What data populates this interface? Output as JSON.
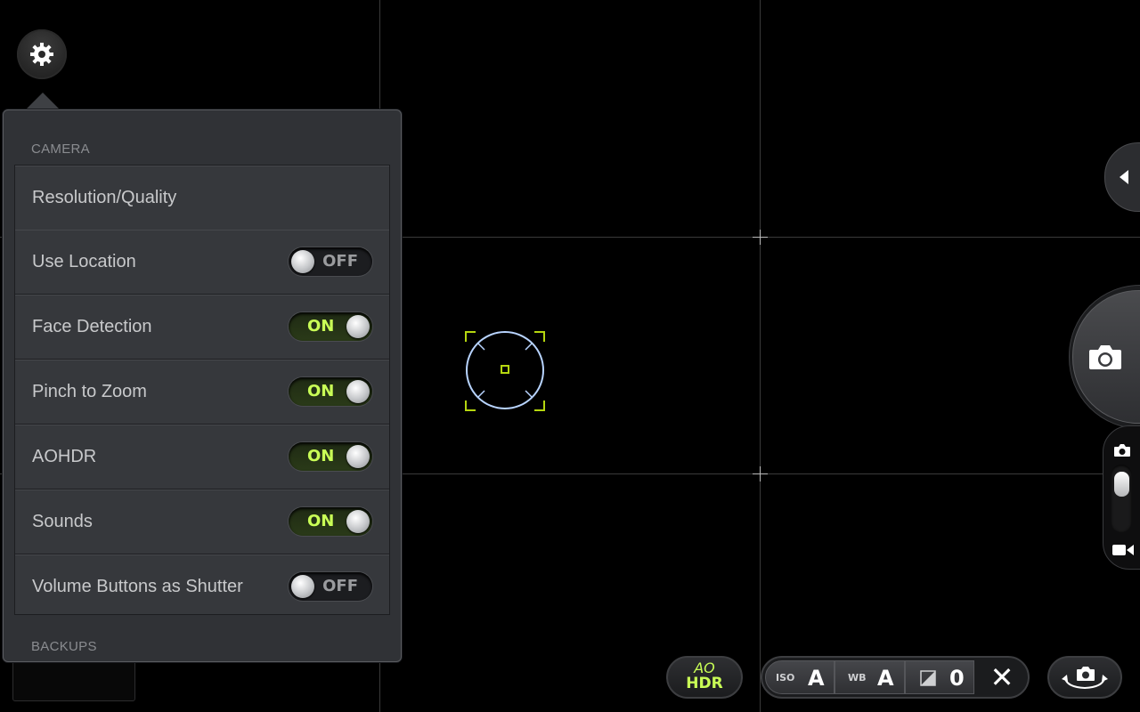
{
  "settings_panel": {
    "camera_header": "CAMERA",
    "backups_header": "BACKUPS",
    "rows": [
      {
        "label": "Resolution/Quality",
        "toggle": null
      },
      {
        "label": "Use Location",
        "toggle": "OFF"
      },
      {
        "label": "Face Detection",
        "toggle": "ON"
      },
      {
        "label": "Pinch to Zoom",
        "toggle": "ON"
      },
      {
        "label": "AOHDR",
        "toggle": "ON"
      },
      {
        "label": "Sounds",
        "toggle": "ON"
      },
      {
        "label": "Volume Buttons as Shutter",
        "toggle": "OFF"
      }
    ]
  },
  "bottom_bar": {
    "hdr_top": "AO",
    "hdr_bottom": "HDR",
    "iso_label": "ISO",
    "iso_value": "A",
    "wb_label": "WB",
    "wb_value": "A",
    "exposure_value": "0",
    "close_glyph": "✕"
  },
  "icons": {
    "settings": "gear-icon",
    "shutter": "camera-icon",
    "photo_mode": "camera-icon",
    "video_mode": "video-camera-icon",
    "expand_tab": "triangle-left-icon",
    "exposure": "exposure-icon",
    "switch_camera": "switch-camera-icon"
  },
  "colors": {
    "accent_green": "#c9ff56",
    "focus_ring": "#b8d4ff",
    "panel_bg": "#303236"
  }
}
